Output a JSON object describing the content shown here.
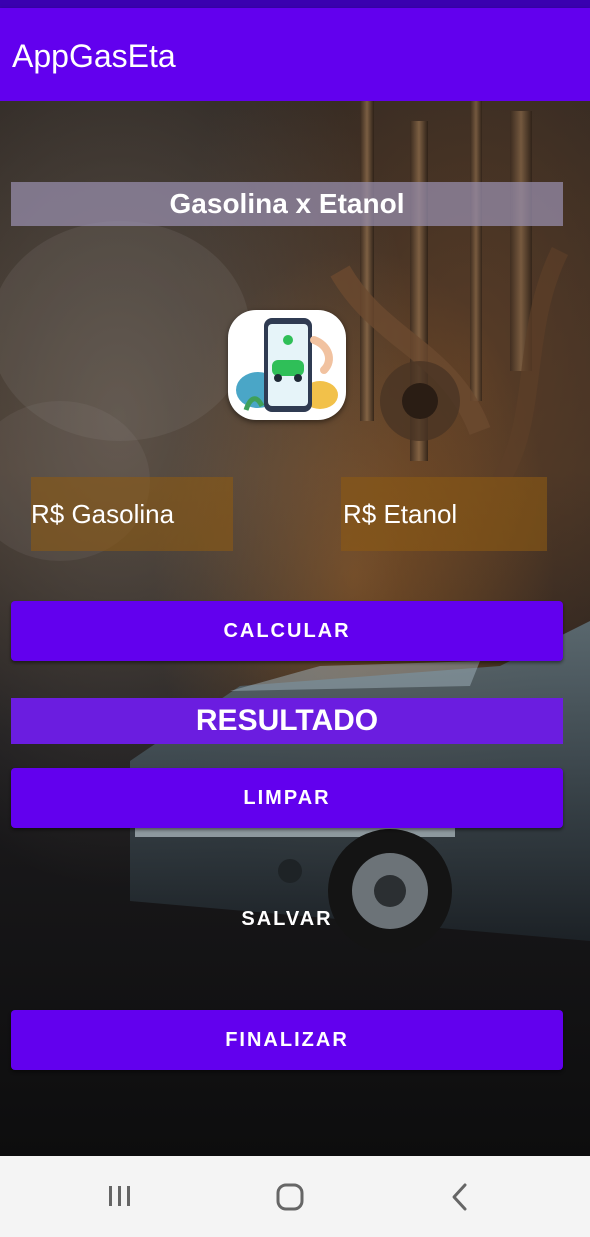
{
  "app": {
    "title": "AppGasEta"
  },
  "main": {
    "heading": "Gasolina x Etanol",
    "inputs": {
      "gasolina_placeholder": "R$ Gasolina",
      "etanol_placeholder": "R$ Etanol"
    },
    "buttons": {
      "calcular": "CALCULAR",
      "limpar": "LIMPAR",
      "salvar": "SALVAR",
      "finalizar": "FINALIZAR"
    },
    "result_label": "RESULTADO"
  },
  "navbar": {
    "icons": [
      "recent-apps-icon",
      "home-icon",
      "back-icon"
    ]
  },
  "colors": {
    "primary": "#6200ee",
    "status_bar": "#3a00b0"
  }
}
